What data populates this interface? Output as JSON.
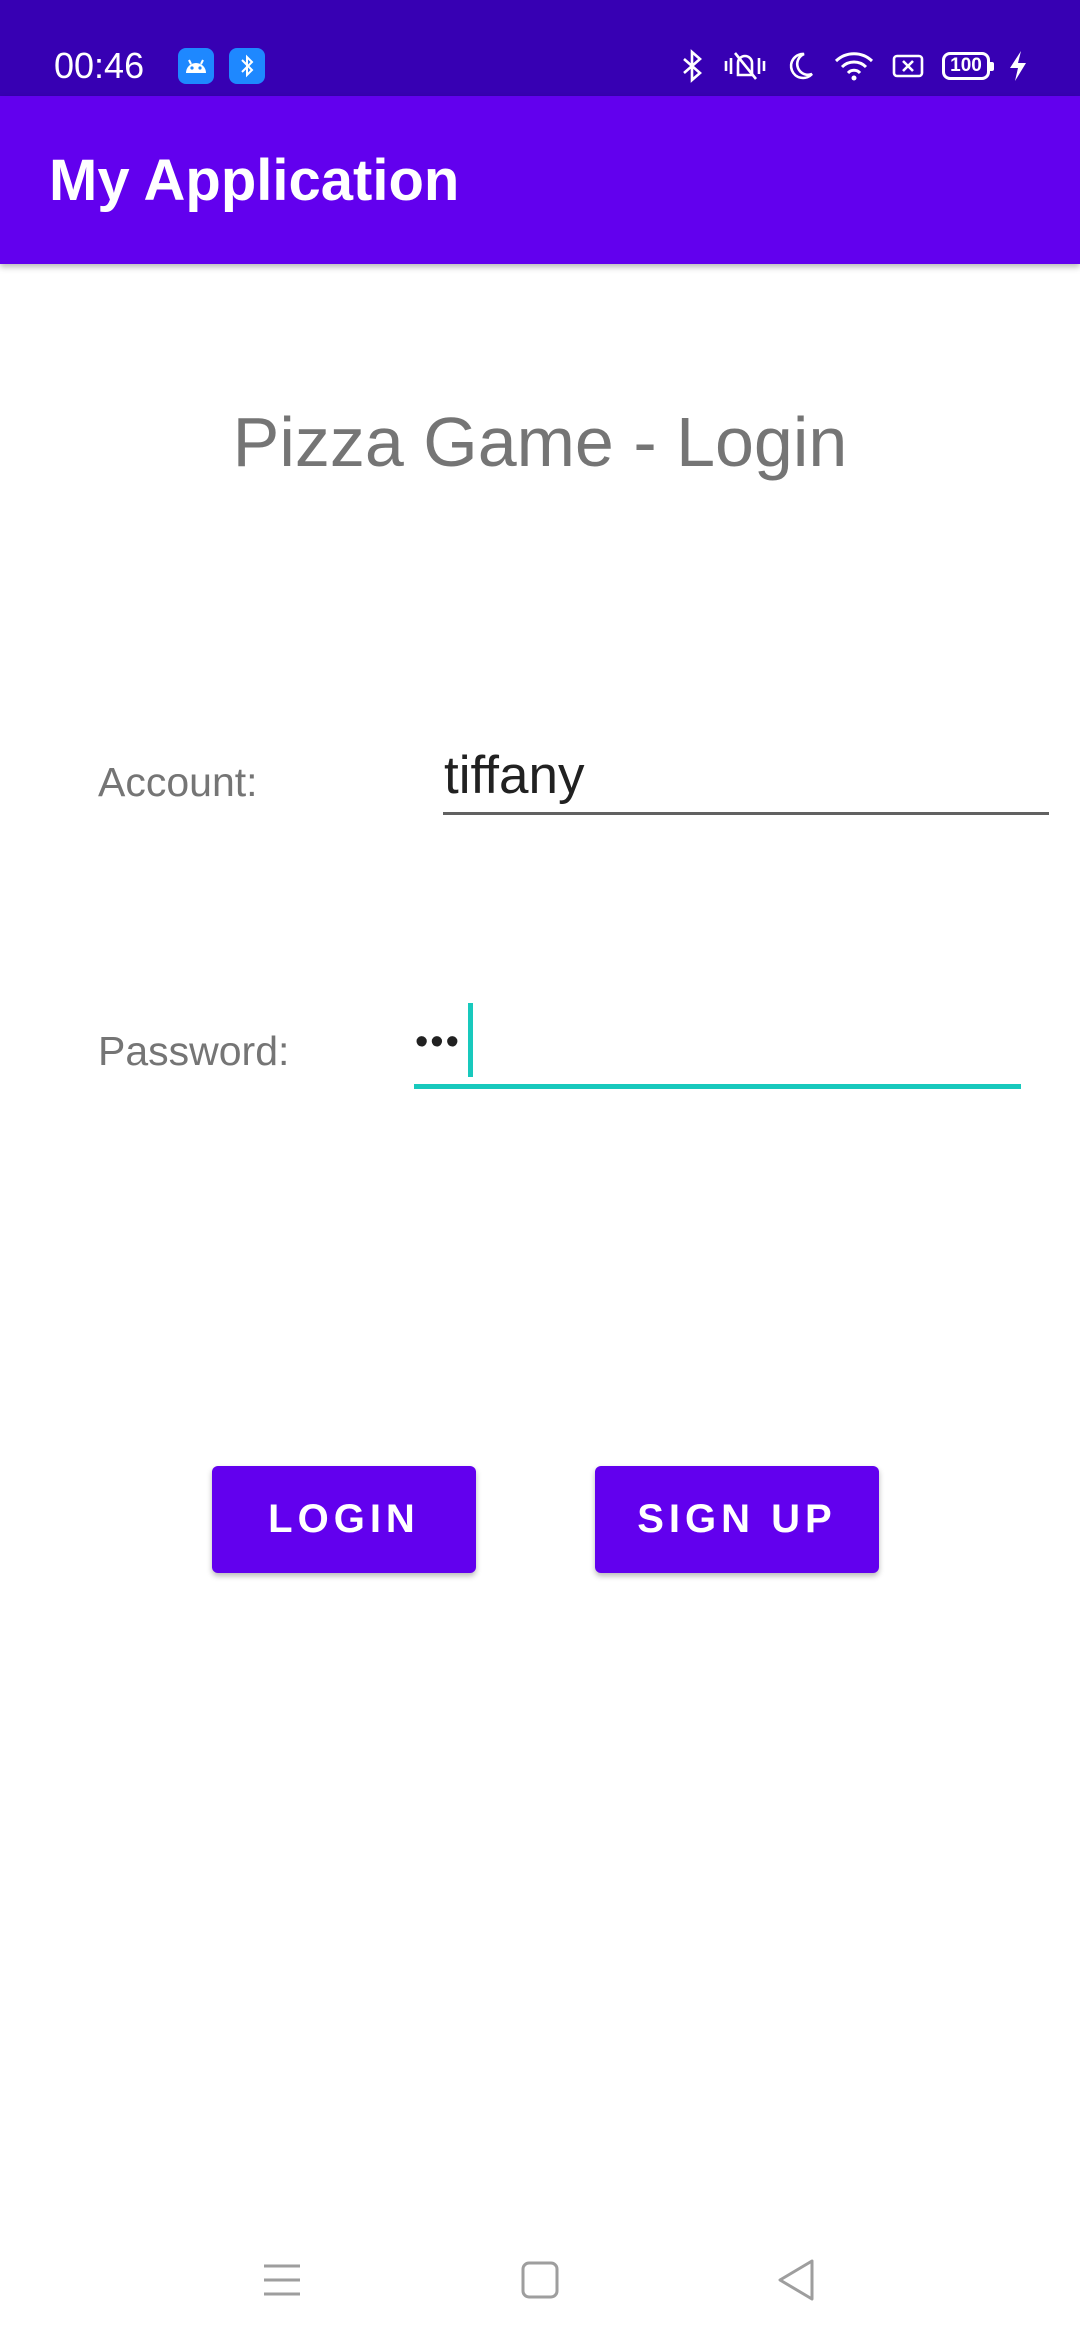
{
  "status_bar": {
    "time": "00:46",
    "battery_level": "100",
    "notification_icons": [
      "android-icon",
      "bluetooth-file-icon"
    ],
    "system_icons": [
      "bluetooth-icon",
      "vibrate-off-icon",
      "moon-icon",
      "wifi-icon",
      "screen-cast-icon",
      "battery-icon",
      "charging-bolt-icon"
    ],
    "background_color": "#3700b3"
  },
  "app_bar": {
    "title": "My Application",
    "background_color": "#6200ee"
  },
  "main": {
    "title": "Pizza Game - Login",
    "account": {
      "label": "Account:",
      "value": "tiffany"
    },
    "password": {
      "label": "Password:",
      "masked_value": "•••",
      "focused": true,
      "accent_color": "#18c9bd"
    },
    "buttons": {
      "login": "LOGIN",
      "signup": "SIGN UP"
    }
  },
  "nav_bar": {
    "items": [
      "menu-icon",
      "home-icon",
      "back-icon"
    ]
  }
}
